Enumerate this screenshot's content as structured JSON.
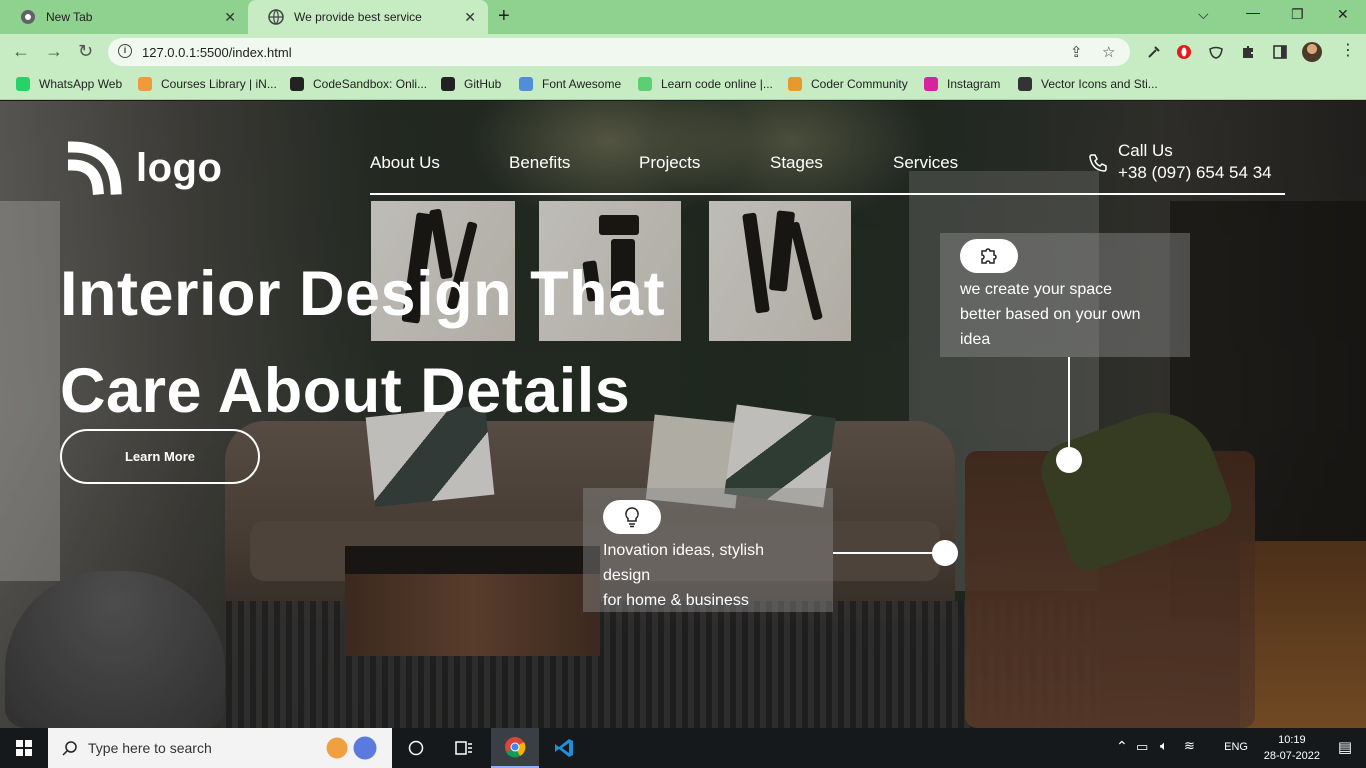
{
  "browser": {
    "tabs": [
      {
        "title": "New Tab",
        "active": false
      },
      {
        "title": "We provide best service",
        "active": true
      }
    ],
    "new_tab": "+",
    "url": "127.0.0.1:5500/index.html",
    "bookmarks": [
      {
        "label": "WhatsApp Web",
        "color": "#25d366"
      },
      {
        "label": "Courses Library | iN...",
        "color": "#f29a3b"
      },
      {
        "label": "CodeSandbox: Onli...",
        "color": "#222222"
      },
      {
        "label": "GitHub",
        "color": "#222222"
      },
      {
        "label": "Font Awesome",
        "color": "#528dd7"
      },
      {
        "label": "Learn code online |...",
        "color": "#5ccf74"
      },
      {
        "label": "Coder Community",
        "color": "#e59a2b"
      },
      {
        "label": "Instagram",
        "color": "#d6249f"
      },
      {
        "label": "Vector Icons and Sti...",
        "color": "#333333"
      }
    ]
  },
  "site": {
    "logo_text": "logo",
    "nav": [
      "About Us",
      "Benefits",
      "Projects",
      "Stages",
      "Services"
    ],
    "call_label": "Call Us",
    "call_number": "+38 (097) 654 54 34",
    "hero_line1": "Interior Design That",
    "hero_line2": "Care About Details",
    "cta_label": "Learn More",
    "card_right_lines": [
      "we create your space",
      "better based on your own",
      "idea"
    ],
    "card_bottom_lines": [
      "Inovation ideas, stylish",
      "design",
      "for home & business"
    ]
  },
  "taskbar": {
    "search_placeholder": "Type here to search",
    "language": "ENG",
    "time": "10:19",
    "date": "28-07-2022"
  },
  "colors": {
    "chrome_green": "#8fd18f",
    "toolbar_green": "#c7ecc4",
    "taskbar": "#16191c"
  }
}
